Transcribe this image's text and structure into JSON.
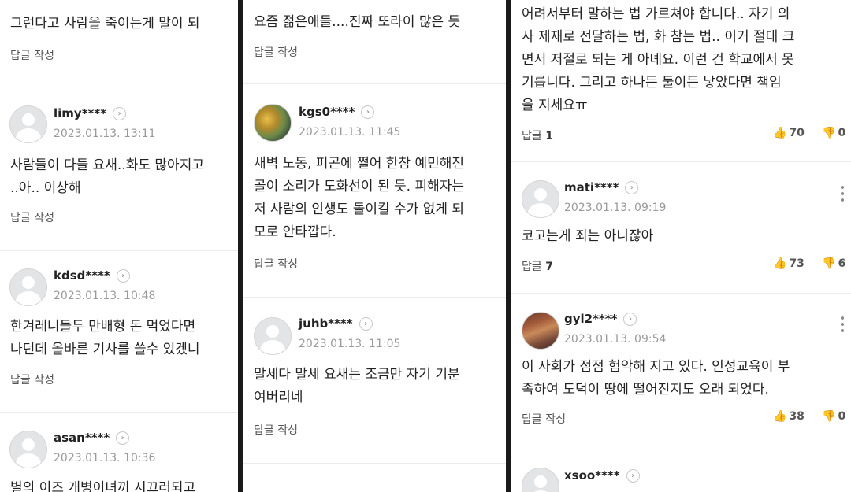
{
  "col1": {
    "top_text": "그런다고 사람을 죽이는게 말이 되",
    "top_reply": "답글 작성",
    "comments": [
      {
        "user": "limy****",
        "date": "2023.01.13. 13:11",
        "line1": "사람들이 다들 요새..화도 많아지고",
        "line2": "..아.. 이상해",
        "reply": "답글 작성"
      },
      {
        "user": "kdsd****",
        "date": "2023.01.13. 10:48",
        "line1": "한겨레니들두 만배형 돈 먹었다면",
        "line2": "나던데 올바른 기사를 쓸수 있겠니",
        "reply": "답글 작성"
      },
      {
        "user": "asan****",
        "date": "2023.01.13. 10:36",
        "line1": "별의 이즈 개병이녀끼 시끄러되고"
      }
    ]
  },
  "col2": {
    "top_text": "요즘 젊은애들....진짜 또라이 많은 듯",
    "top_reply": "답글 작성",
    "comments": [
      {
        "user": "kgs0****",
        "date": "2023.01.13. 11:45",
        "line1": "새벽 노동, 피곤에 쩔어 한참 예민해진",
        "line2": "골이 소리가 도화선이 된 듯. 피해자는",
        "line3": "저 사람의 인생도 돌이킬 수가 없게 되",
        "line4": "모로 안타깝다.",
        "reply": "답글 작성"
      },
      {
        "user": "juhb****",
        "date": "2023.01.13. 11:05",
        "line1": "말세다 말세 요새는 조금만 자기 기분",
        "line2": "여버리네",
        "reply": "답글 작성"
      }
    ]
  },
  "col3": {
    "top_lines": [
      "어려서부터 말하는 법 가르쳐야 합니다.. 자기 의",
      "사 제재로 전달하는 법, 화 참는 법.. 이거 절대 크",
      "면서 저절로 되는 게 아녜요. 이런 건 학교에서 못",
      "기릅니다. 그리고 하나든 둘이든 낳았다면 책임",
      "을 지세요ㅠ"
    ],
    "top_reply_label": "답글",
    "top_reply_count": "1",
    "top_likes": "70",
    "top_dislikes": "0",
    "comments": [
      {
        "user": "mati****",
        "date": "2023.01.13. 09:19",
        "line1": "코고는게 죄는 아니잖아",
        "reply_label": "답글",
        "reply_count": "7",
        "likes": "73",
        "dislikes": "6"
      },
      {
        "user": "gyl2****",
        "date": "2023.01.13. 09:54",
        "line1": "이 사회가 점점 험악해 지고 있다. 인성교육이 부",
        "line2": "족하여 도덕이 땅에 떨어진지도 오래 되었다.",
        "reply": "답글 작성",
        "likes": "38",
        "dislikes": "0"
      },
      {
        "user": "xsoo****"
      }
    ]
  },
  "icons": {
    "chevron": "›",
    "like": "👍",
    "dislike": "👎"
  }
}
